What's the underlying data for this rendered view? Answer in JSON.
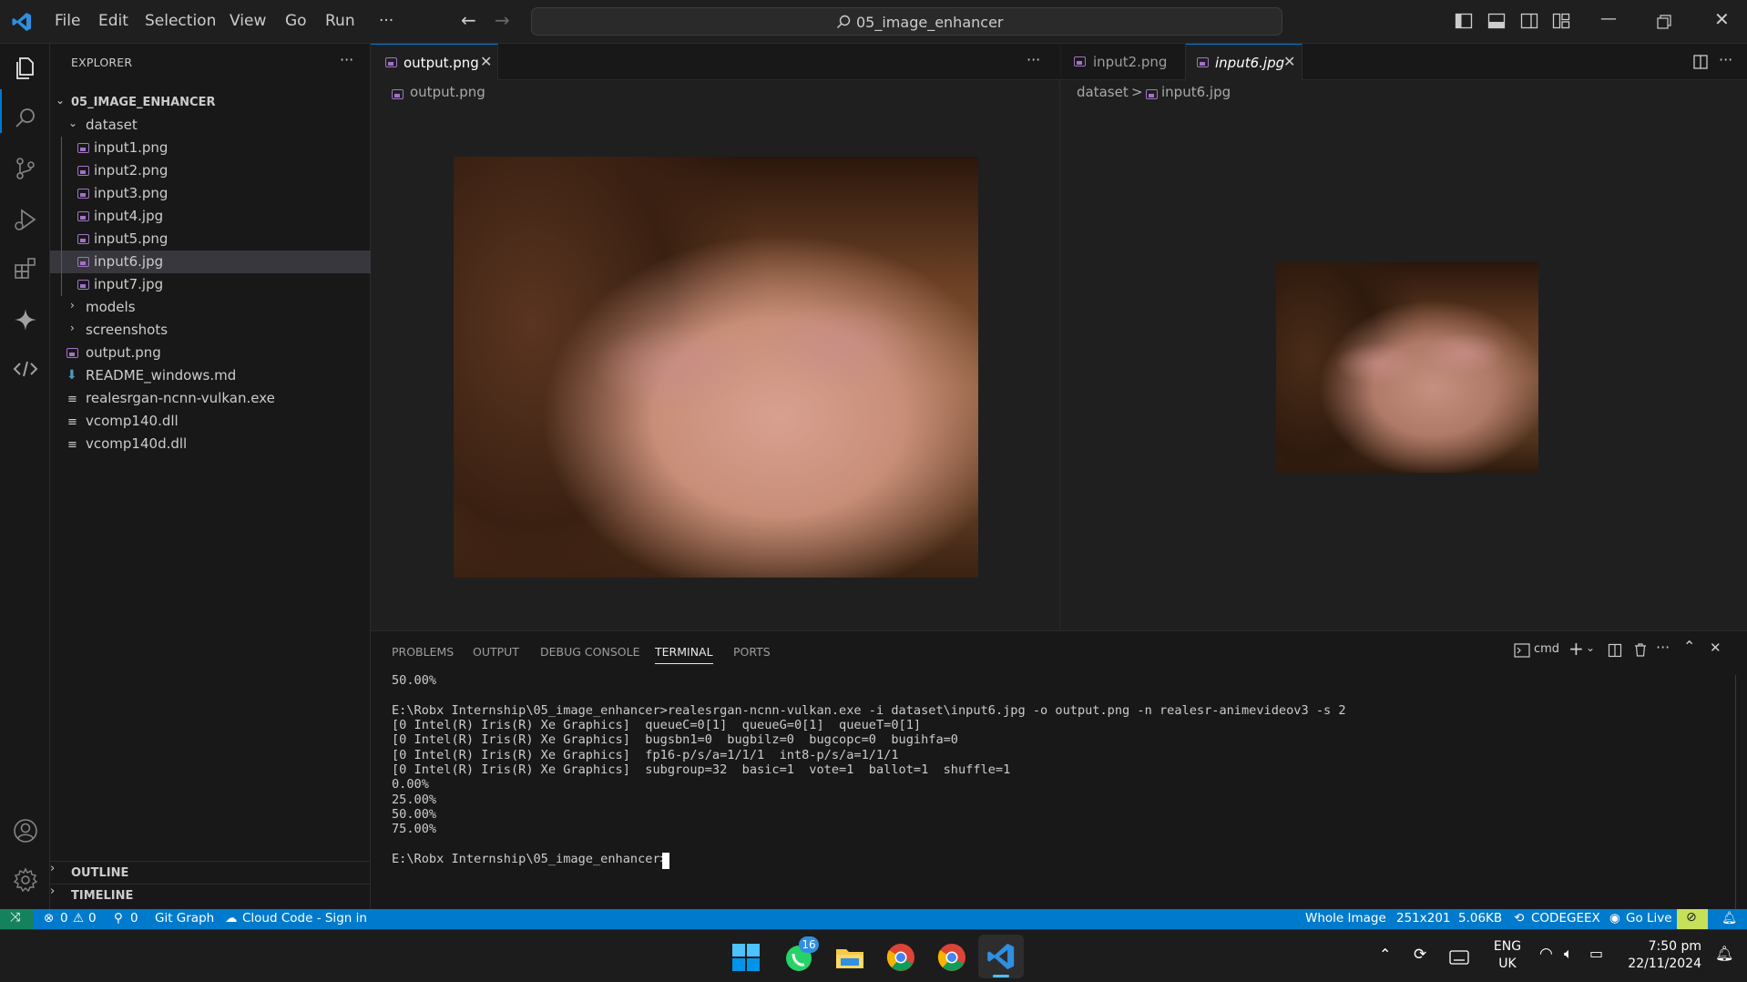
{
  "titlebar": {
    "menu": [
      "File",
      "Edit",
      "Selection",
      "View",
      "Go",
      "Run",
      "···"
    ],
    "search_text": "05_image_enhancer"
  },
  "sidebar": {
    "title": "EXPLORER",
    "root": "05_IMAGE_ENHANCER",
    "folder_dataset": "dataset",
    "dataset_files": [
      "input1.png",
      "input2.png",
      "input3.png",
      "input4.jpg",
      "input5.png",
      "input6.jpg",
      "input7.jpg"
    ],
    "folder_models": "models",
    "folder_screenshots": "screenshots",
    "root_files": [
      "output.png",
      "README_windows.md",
      "realesrgan-ncnn-vulkan.exe",
      "vcomp140.dll",
      "vcomp140d.dll"
    ],
    "outline": "OUTLINE",
    "timeline": "TIMELINE"
  },
  "editor_left": {
    "tab_label": "output.png",
    "breadcrumb": "output.png"
  },
  "editor_right": {
    "tab1_label": "input2.png",
    "tab2_label": "input6.jpg",
    "breadcrumb_folder": "dataset",
    "breadcrumb_sep": ">",
    "breadcrumb_file": "input6.jpg"
  },
  "panel": {
    "tabs": [
      "PROBLEMS",
      "OUTPUT",
      "DEBUG CONSOLE",
      "TERMINAL",
      "PORTS"
    ],
    "shell_label": "cmd",
    "terminal_lines": [
      "50.00%",
      "",
      "E:\\Robx Internship\\05_image_enhancer>realesrgan-ncnn-vulkan.exe -i dataset\\input6.jpg -o output.png -n realesr-animevideov3 -s 2",
      "[0 Intel(R) Iris(R) Xe Graphics]  queueC=0[1]  queueG=0[1]  queueT=0[1]",
      "[0 Intel(R) Iris(R) Xe Graphics]  bugsbn1=0  bugbilz=0  bugcopc=0  bugihfa=0",
      "[0 Intel(R) Iris(R) Xe Graphics]  fp16-p/s/a=1/1/1  int8-p/s/a=1/1/1",
      "[0 Intel(R) Iris(R) Xe Graphics]  subgroup=32  basic=1  vote=1  ballot=1  shuffle=1",
      "0.00%",
      "25.00%",
      "50.00%",
      "75.00%",
      "",
      "E:\\Robx Internship\\05_image_enhancer>"
    ]
  },
  "statusbar": {
    "errors": "0",
    "warnings": "0",
    "ports": "0",
    "git_graph": "Git Graph",
    "cloud_code": "Cloud Code - Sign in",
    "whole_image": "Whole Image",
    "dimensions": "251x201",
    "size": "5.06KB",
    "codegeex": "CODEGEEX",
    "go_live": "Go Live"
  },
  "taskbar": {
    "whatsapp_badge": "16",
    "lang_line1": "ENG",
    "lang_line2": "UK",
    "time": "7:50 pm",
    "date": "22/11/2024"
  },
  "colors": {
    "accent": "#0078d4",
    "statusbar": "#007acc",
    "remote": "#16825d",
    "image_icon": "#a074c4"
  }
}
